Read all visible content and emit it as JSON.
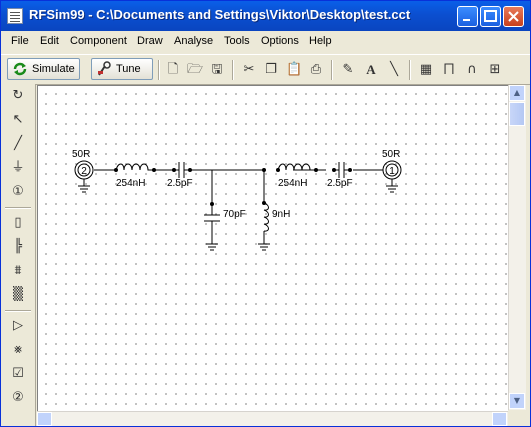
{
  "window": {
    "title": "RFSim99 - C:\\Documents and Settings\\Viktor\\Desktop\\test.cct"
  },
  "menu": {
    "items": [
      {
        "label": "File"
      },
      {
        "label": "Edit"
      },
      {
        "label": "Component"
      },
      {
        "label": "Draw"
      },
      {
        "label": "Analyse"
      },
      {
        "label": "Tools"
      },
      {
        "label": "Options"
      },
      {
        "label": "Help"
      }
    ]
  },
  "toolbar": {
    "simulate_label": "Simulate",
    "tune_label": "Tune",
    "icons": [
      "new-file-icon",
      "open-folder-icon",
      "save-icon",
      "cut-icon",
      "copy-icon",
      "paste-icon",
      "print-icon",
      "pencil-icon",
      "text-icon",
      "line-icon",
      "calculator-icon",
      "ruler-icon",
      "tuning-fork-icon",
      "chart-icon"
    ]
  },
  "left_toolbar": {
    "icons": [
      "rotate-icon",
      "pointer-icon",
      "wire-icon",
      "ground-icon",
      "port-icon",
      "resistor-icon",
      "capacitor-icon",
      "inductor-icon",
      "transformer-icon",
      "amplifier-icon",
      "filter-icon",
      "component-icon",
      "two-port-icon"
    ]
  },
  "schematic": {
    "port_left": {
      "number": "2",
      "impedance": "50R"
    },
    "port_right": {
      "number": "1",
      "impedance": "50R"
    },
    "inductor_left": "254nH",
    "capacitor_left": "2.5pF",
    "shunt_capacitor": "70pF",
    "shunt_inductor": "9nH",
    "inductor_right": "254nH",
    "capacitor_right": "2.5pF"
  }
}
